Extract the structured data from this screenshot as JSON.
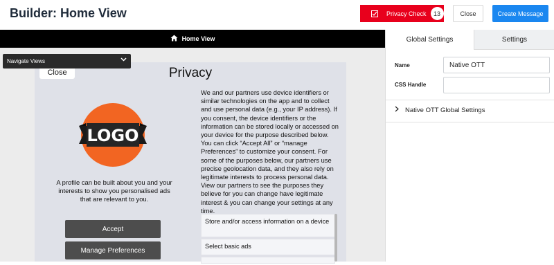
{
  "header": {
    "title": "Builder: Home View",
    "privacy_check_label": "Privacy Check",
    "privacy_check_count": "13",
    "close_label": "Close",
    "create_label": "Create Message"
  },
  "canvas": {
    "bar_label": "Home View",
    "home_icon": "home-icon",
    "navigate_views_label": "Navigate Views"
  },
  "panel": {
    "close_label": "Close",
    "title": "Privacy",
    "logo_text": "LOGO",
    "profile_text": "A profile can be built about you and your interests to show you personalised ads that are relevant to you.",
    "accept_label": "Accept",
    "manage_label": "Manage Preferences",
    "body_text": "We and our partners use device identifiers or similar technologies on the app and to collect and use personal data (e.g., your IP address). If you consent, the device identifiers or the information can be stored locally or accessed on your device for the purpose described below. You can click “Accept All” or “manage Preferences” to customize your consent. For some of the purposes below, our partners use precise geolocation data, and they also rely on legitimate interests to process personal data. View our partners to see the purposes they believe for you can change have legitimate interest & you can change your settings at any time.",
    "purposes": [
      "Store and/or access information on a device",
      "Select basic ads",
      ""
    ]
  },
  "sidebar": {
    "tab_global": "Global Settings",
    "tab_settings": "Settings",
    "name_label": "Name",
    "name_value": "Native OTT",
    "css_label": "CSS Handle",
    "css_value": "",
    "ott_label": "Native OTT Global Settings"
  },
  "colors": {
    "privacy_red": "#e8001c",
    "create_blue": "#1a87f0",
    "logo_orange": "#f26522"
  }
}
